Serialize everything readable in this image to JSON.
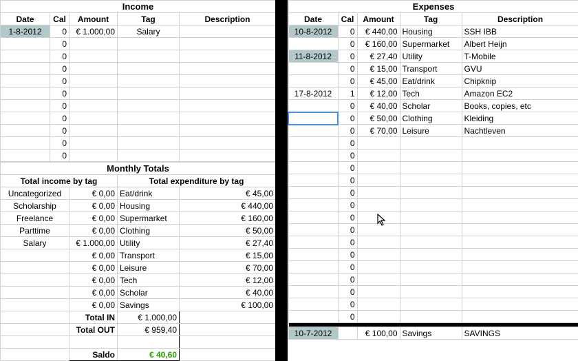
{
  "columns": {
    "date": "Date",
    "cal": "Cal",
    "amount": "Amount",
    "tag": "Tag",
    "description": "Description"
  },
  "income": {
    "title": "Income",
    "rows": [
      {
        "date": "1-8-2012",
        "date_hl": true,
        "cal": "0",
        "amount": "€ 1.000,00",
        "tag": "Salary",
        "description": ""
      },
      {
        "date": "",
        "cal": "0",
        "amount": "",
        "tag": "",
        "description": ""
      },
      {
        "date": "",
        "cal": "0",
        "amount": "",
        "tag": "",
        "description": ""
      },
      {
        "date": "",
        "cal": "0",
        "amount": "",
        "tag": "",
        "description": ""
      },
      {
        "date": "",
        "cal": "0",
        "amount": "",
        "tag": "",
        "description": ""
      },
      {
        "date": "",
        "cal": "0",
        "amount": "",
        "tag": "",
        "description": ""
      },
      {
        "date": "",
        "cal": "0",
        "amount": "",
        "tag": "",
        "description": ""
      },
      {
        "date": "",
        "cal": "0",
        "amount": "",
        "tag": "",
        "description": ""
      },
      {
        "date": "",
        "cal": "0",
        "amount": "",
        "tag": "",
        "description": ""
      },
      {
        "date": "",
        "cal": "0",
        "amount": "",
        "tag": "",
        "description": ""
      },
      {
        "date": "",
        "cal": "0",
        "amount": "",
        "tag": "",
        "description": ""
      }
    ]
  },
  "monthly_totals": {
    "title": "Monthly Totals",
    "income_header": "Total income by tag",
    "expense_header": "Total expenditure by tag",
    "income_by_tag": [
      {
        "tag": "Uncategorized",
        "amount": "€ 0,00"
      },
      {
        "tag": "Scholarship",
        "amount": "€ 0,00"
      },
      {
        "tag": "Freelance",
        "amount": "€ 0,00"
      },
      {
        "tag": "Parttime",
        "amount": "€ 0,00"
      },
      {
        "tag": "Salary",
        "amount": "€ 1.000,00"
      },
      {
        "tag": "",
        "amount": "€ 0,00"
      },
      {
        "tag": "",
        "amount": "€ 0,00"
      },
      {
        "tag": "",
        "amount": "€ 0,00"
      },
      {
        "tag": "",
        "amount": "€ 0,00"
      },
      {
        "tag": "",
        "amount": "€ 0,00"
      }
    ],
    "expense_by_tag": [
      {
        "tag": "Eat/drink",
        "amount": "€ 45,00"
      },
      {
        "tag": "Housing",
        "amount": "€ 440,00"
      },
      {
        "tag": "Supermarket",
        "amount": "€ 160,00"
      },
      {
        "tag": "Clothing",
        "amount": "€ 50,00"
      },
      {
        "tag": "Utility",
        "amount": "€ 27,40"
      },
      {
        "tag": "Transport",
        "amount": "€ 15,00"
      },
      {
        "tag": "Leisure",
        "amount": "€ 70,00"
      },
      {
        "tag": "Tech",
        "amount": "€ 12,00"
      },
      {
        "tag": "Scholar",
        "amount": "€ 40,00"
      },
      {
        "tag": "Savings",
        "amount": "€ 100,00"
      }
    ],
    "total_in_label": "Total IN",
    "total_in_value": "€ 1.000,00",
    "total_out_label": "Total OUT",
    "total_out_value": "€ 959,40",
    "saldo_label": "Saldo",
    "saldo_value": "€ 40,60"
  },
  "expenses": {
    "title": "Expenses",
    "rows": [
      {
        "date": "10-8-2012",
        "date_hl": true,
        "cal": "0",
        "amount": "€ 440,00",
        "tag": "Housing",
        "description": "SSH IBB"
      },
      {
        "date": "",
        "cal": "0",
        "amount": "€ 160,00",
        "tag": "Supermarket",
        "description": "Albert Heijn"
      },
      {
        "date": "11-8-2012",
        "date_hl": true,
        "cal": "0",
        "amount": "€ 27,40",
        "tag": "Utility",
        "description": "T-Mobile"
      },
      {
        "date": "",
        "cal": "0",
        "amount": "€ 15,00",
        "tag": "Transport",
        "description": "GVU"
      },
      {
        "date": "",
        "cal": "0",
        "amount": "€ 45,00",
        "tag": "Eat/drink",
        "description": "Chipknip"
      },
      {
        "date": "17-8-2012",
        "date_hl": false,
        "cal": "1",
        "amount": "€ 12,00",
        "tag": "Tech",
        "description": "Amazon EC2"
      },
      {
        "date": "",
        "cal": "0",
        "amount": "€ 40,00",
        "tag": "Scholar",
        "description": "Books, copies, etc"
      },
      {
        "date": "",
        "active": true,
        "cal": "0",
        "amount": "€ 50,00",
        "tag": "Clothing",
        "description": "Kleiding"
      },
      {
        "date": "",
        "cal": "0",
        "amount": "€ 70,00",
        "tag": "Leisure",
        "description": "Nachtleven"
      }
    ],
    "empty_count": 15,
    "final_row": {
      "date": "10-7-2012",
      "date_hl": true,
      "cal": "",
      "amount": "€ 100,00",
      "tag": "Savings",
      "description": "SAVINGS"
    }
  }
}
